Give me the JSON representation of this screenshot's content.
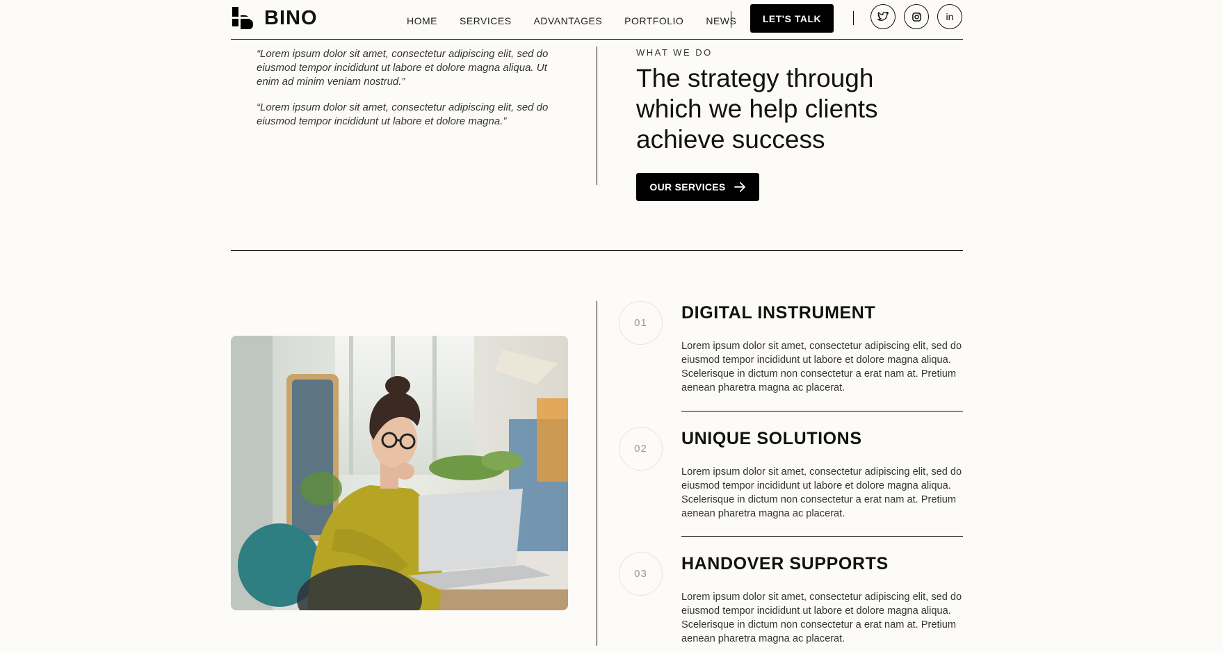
{
  "header": {
    "logo_text": "BINO",
    "nav": [
      "HOME",
      "SERVICES",
      "ADVANTAGES",
      "PORTFOLIO",
      "NEWS"
    ],
    "cta_label": "LET'S TALK",
    "socials": [
      "twitter-icon",
      "instagram-icon",
      "linkedin-icon"
    ],
    "linkedin_glyph": "in"
  },
  "quotes": [
    "“Lorem ipsum dolor sit amet, consectetur adipiscing elit, sed do eiusmod tempor incididunt ut labore et dolore magna aliqua. Ut enim ad minim veniam nostrud.”",
    "“Lorem ipsum dolor sit amet, consectetur adipiscing elit, sed do eiusmod tempor incididunt ut labore et dolore magna.”"
  ],
  "what_we_do": {
    "eyebrow": "WHAT WE DO",
    "headline": "The strategy through which we help clients achieve success",
    "button_label": "OUR SERVICES"
  },
  "features": [
    {
      "number": "01",
      "title": "DIGITAL INSTRUMENT",
      "text": "Lorem ipsum dolor sit amet, consectetur adipiscing elit, sed do eiusmod tempor incididunt ut labore et dolore magna aliqua. Scelerisque in dictum non consectetur a erat nam at. Pretium aenean pharetra magna ac placerat."
    },
    {
      "number": "02",
      "title": "UNIQUE SOLUTIONS",
      "text": "Lorem ipsum dolor sit amet, consectetur adipiscing elit, sed do eiusmod tempor incididunt ut labore et dolore magna aliqua. Scelerisque in dictum non consectetur a erat nam at. Pretium aenean pharetra magna ac placerat."
    },
    {
      "number": "03",
      "title": "HANDOVER SUPPORTS",
      "text": "Lorem ipsum dolor sit amet, consectetur adipiscing elit, sed do eiusmod tempor incididunt ut labore et dolore magna aliqua. Scelerisque in dictum non consectetur a erat nam at. Pretium aenean pharetra magna ac placerat."
    }
  ],
  "colors": {
    "background": "#fcfbf7",
    "ink": "#111111",
    "button": "#000000",
    "number_circle_border": "#e7e4dc"
  }
}
